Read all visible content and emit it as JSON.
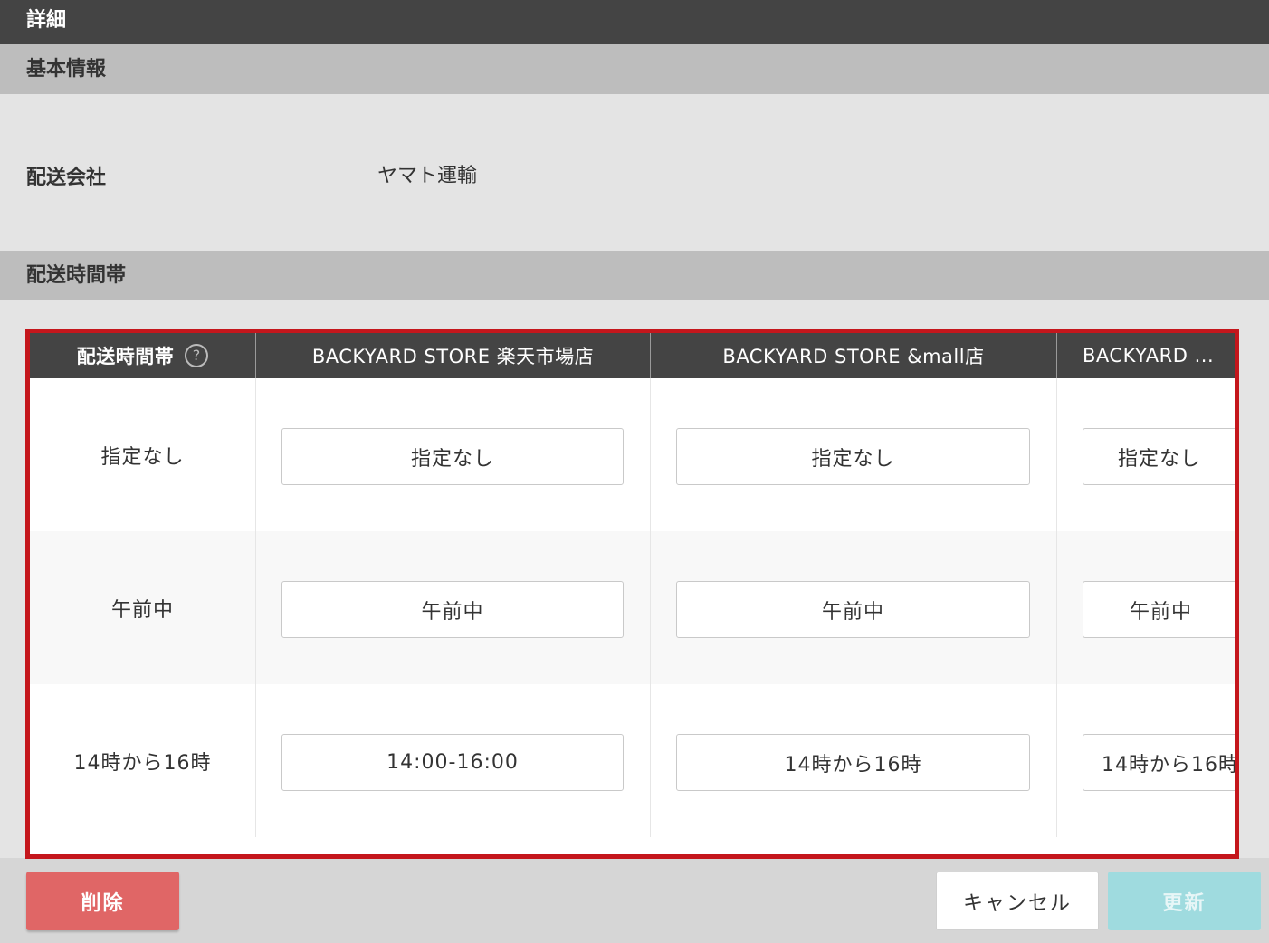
{
  "window": {
    "title": "詳細"
  },
  "sections": {
    "basic": "基本情報",
    "slots": "配送時間帯"
  },
  "basic": {
    "carrier_label": "配送会社",
    "carrier_value": "ヤマト運輸"
  },
  "table": {
    "headers": [
      "配送時間帯",
      "BACKYARD STORE 楽天市場店",
      "BACKYARD STORE &mall店",
      "BACKYARD ..."
    ],
    "help_icon": "question-circle-icon",
    "rows": [
      {
        "label": "指定なし",
        "values": [
          "指定なし",
          "指定なし",
          "指定なし"
        ]
      },
      {
        "label": "午前中",
        "values": [
          "午前中",
          "午前中",
          "午前中"
        ]
      },
      {
        "label": "14時から16時",
        "values": [
          "14:00-16:00",
          "14時から16時",
          "14時から16時"
        ]
      }
    ]
  },
  "footer": {
    "delete_label": "削除",
    "cancel_label": "キャンセル",
    "update_label": "更新"
  },
  "colors": {
    "highlight_border": "#c4161c",
    "delete": "#e06666",
    "update": "#9fdbdf"
  }
}
